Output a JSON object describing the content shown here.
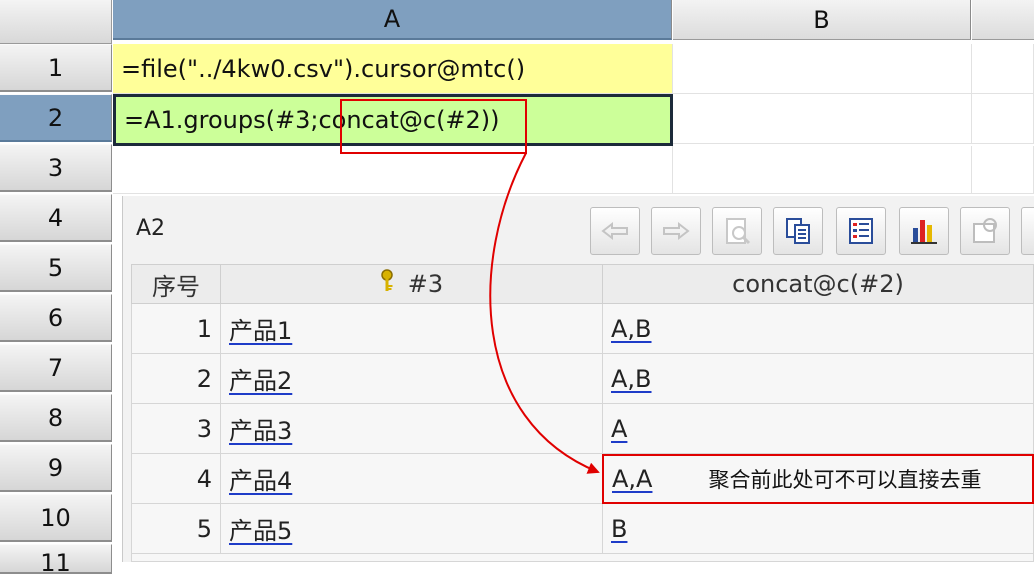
{
  "columns": [
    "A",
    "B"
  ],
  "rows": [
    "1",
    "2",
    "3",
    "4",
    "5",
    "6",
    "7",
    "8",
    "9",
    "10",
    "11"
  ],
  "cells": {
    "a1": "=file(\"../4kw0.csv\").cursor@mtc()",
    "a2_prefix": "=A1.groups(#3;",
    "a2_highlight": "concat@c(#2)",
    "a2_suffix": ")"
  },
  "panel": {
    "cell_name": "A2",
    "toolbar": [
      "back-arrow-icon",
      "forward-arrow-icon",
      "search-doc-icon",
      "copy-icon",
      "list-icon",
      "chart-icon",
      "settings-icon"
    ],
    "headers": [
      "序号",
      "#3",
      "concat@c(#2)"
    ],
    "rows": [
      {
        "idx": "1",
        "key": "产品1",
        "val": "A,B"
      },
      {
        "idx": "2",
        "key": "产品2",
        "val": "A,B"
      },
      {
        "idx": "3",
        "key": "产品3",
        "val": "A"
      },
      {
        "idx": "4",
        "key": "产品4",
        "val": "A,A"
      },
      {
        "idx": "5",
        "key": "产品5",
        "val": "B"
      }
    ]
  },
  "annotation": {
    "note": "聚合前此处可不可以直接去重",
    "color": "#e00000"
  }
}
